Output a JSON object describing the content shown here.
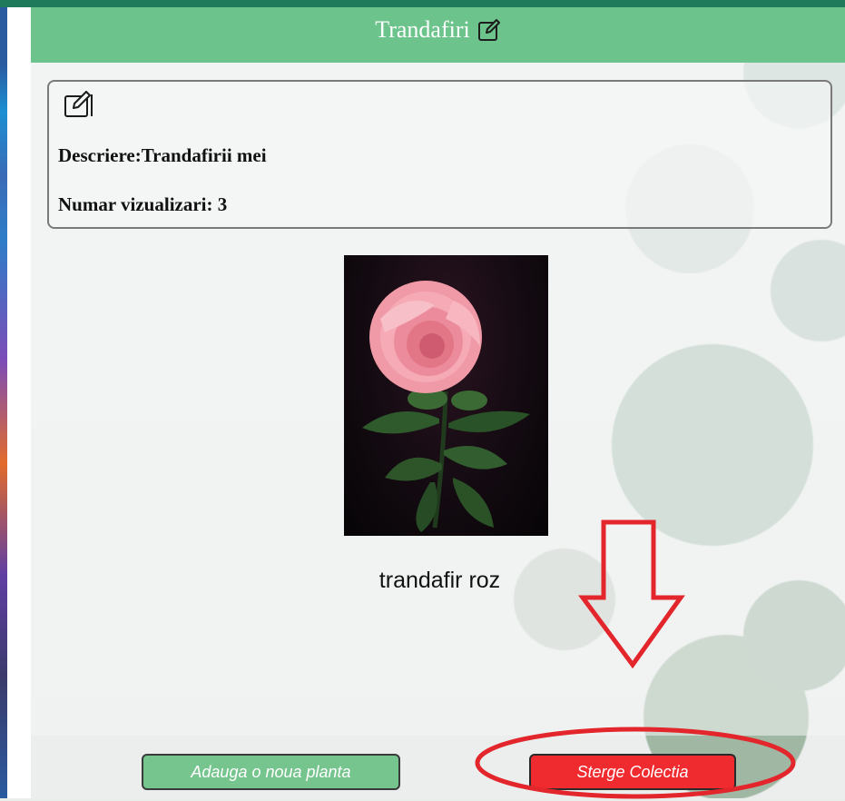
{
  "header": {
    "title": "Trandafiri",
    "edit_icon": "edit-icon"
  },
  "info": {
    "edit_icon": "edit-icon",
    "description": "Descriere:Trandafirii mei",
    "views": "Numar vizualizari: 3"
  },
  "plant": {
    "name": "trandafir roz"
  },
  "buttons": {
    "add_label": "Adauga o noua planta",
    "delete_label": "Sterge Colectia"
  },
  "colors": {
    "header": "#6cc38b",
    "add_button": "#76c48e",
    "delete_button": "#ef2b2f",
    "annotation": "#e3262c"
  }
}
